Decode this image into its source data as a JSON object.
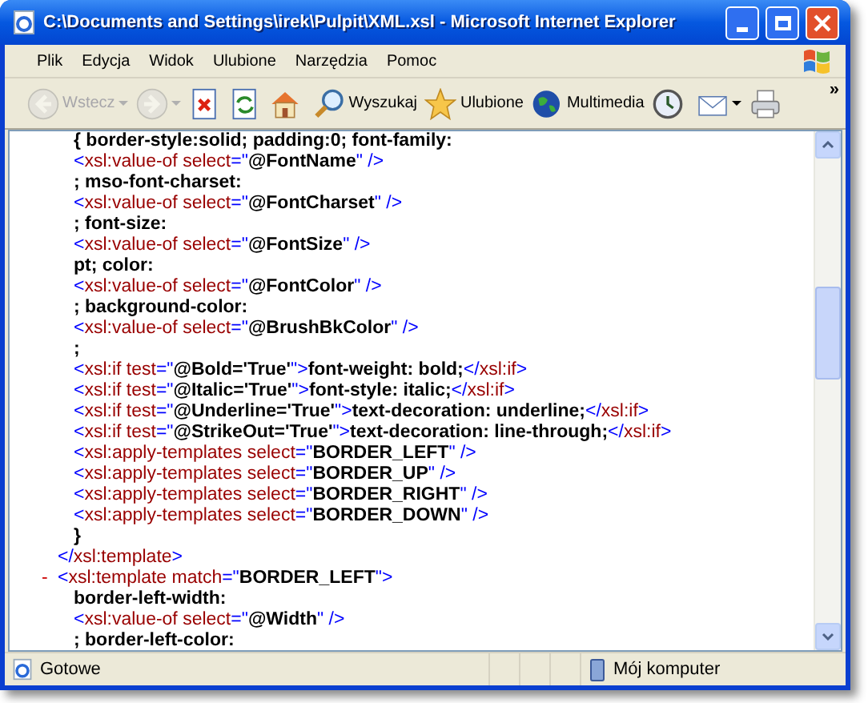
{
  "window": {
    "title": "C:\\Documents and Settings\\irek\\Pulpit\\XML.xsl - Microsoft Internet Explorer"
  },
  "menu": [
    "Plik",
    "Edycja",
    "Widok",
    "Ulubione",
    "Narzędzia",
    "Pomoc"
  ],
  "toolbar": [
    {
      "label": "Wstecz",
      "disabled": true,
      "dropdown": true
    },
    {
      "disabled": true,
      "dropdown": true
    },
    {
      "disabled": false
    },
    {
      "disabled": false
    },
    {
      "disabled": false
    },
    {
      "label": "Wyszukaj",
      "disabled": false
    },
    {
      "label": "Ulubione",
      "disabled": false
    },
    {
      "label": "Multimedia",
      "disabled": false
    },
    {
      "disabled": false
    },
    {
      "disabled": false,
      "dropdown": true
    },
    {
      "disabled": false
    }
  ],
  "toolbar_overflow": "»",
  "document": [
    {
      "children": [
        {
          "tokens": [
            {
              "kind": "text",
              "text": "{ border-style:solid; padding:0; font-family:"
            }
          ]
        },
        {
          "tokens": [
            {
              "kind": "markup",
              "text": "<"
            },
            {
              "kind": "name",
              "text": "xsl:value-of select"
            },
            {
              "kind": "markup",
              "text": "=\""
            },
            {
              "kind": "value",
              "text": "@FontName"
            },
            {
              "kind": "markup",
              "text": "\" />"
            }
          ]
        },
        {
          "tokens": [
            {
              "kind": "text",
              "text": "; mso-font-charset:"
            }
          ]
        },
        {
          "tokens": [
            {
              "kind": "markup",
              "text": "<"
            },
            {
              "kind": "name",
              "text": "xsl:value-of select"
            },
            {
              "kind": "markup",
              "text": "=\""
            },
            {
              "kind": "value",
              "text": "@FontCharset"
            },
            {
              "kind": "markup",
              "text": "\" />"
            }
          ]
        },
        {
          "tokens": [
            {
              "kind": "text",
              "text": "; font-size:"
            }
          ]
        },
        {
          "tokens": [
            {
              "kind": "markup",
              "text": "<"
            },
            {
              "kind": "name",
              "text": "xsl:value-of select"
            },
            {
              "kind": "markup",
              "text": "=\""
            },
            {
              "kind": "value",
              "text": "@FontSize"
            },
            {
              "kind": "markup",
              "text": "\" />"
            }
          ]
        },
        {
          "tokens": [
            {
              "kind": "text",
              "text": "pt; color:"
            }
          ]
        },
        {
          "tokens": [
            {
              "kind": "markup",
              "text": "<"
            },
            {
              "kind": "name",
              "text": "xsl:value-of select"
            },
            {
              "kind": "markup",
              "text": "=\""
            },
            {
              "kind": "value",
              "text": "@FontColor"
            },
            {
              "kind": "markup",
              "text": "\" />"
            }
          ]
        },
        {
          "tokens": [
            {
              "kind": "text",
              "text": "; background-color:"
            }
          ]
        },
        {
          "tokens": [
            {
              "kind": "markup",
              "text": "<"
            },
            {
              "kind": "name",
              "text": "xsl:value-of select"
            },
            {
              "kind": "markup",
              "text": "=\""
            },
            {
              "kind": "value",
              "text": "@BrushBkColor"
            },
            {
              "kind": "markup",
              "text": "\" />"
            }
          ]
        },
        {
          "tokens": [
            {
              "kind": "text",
              "text": ";"
            }
          ]
        },
        {
          "tokens": [
            {
              "kind": "markup",
              "text": "<"
            },
            {
              "kind": "name",
              "text": "xsl:if test"
            },
            {
              "kind": "markup",
              "text": "=\""
            },
            {
              "kind": "value",
              "text": "@Bold='True'"
            },
            {
              "kind": "markup",
              "text": "\">"
            },
            {
              "kind": "text",
              "text": "font-weight: bold;"
            },
            {
              "kind": "markup",
              "text": "</"
            },
            {
              "kind": "name",
              "text": "xsl:if"
            },
            {
              "kind": "markup",
              "text": ">"
            }
          ]
        },
        {
          "tokens": [
            {
              "kind": "markup",
              "text": "<"
            },
            {
              "kind": "name",
              "text": "xsl:if test"
            },
            {
              "kind": "markup",
              "text": "=\""
            },
            {
              "kind": "value",
              "text": "@Italic='True'"
            },
            {
              "kind": "markup",
              "text": "\">"
            },
            {
              "kind": "text",
              "text": "font-style: italic;"
            },
            {
              "kind": "markup",
              "text": "</"
            },
            {
              "kind": "name",
              "text": "xsl:if"
            },
            {
              "kind": "markup",
              "text": ">"
            }
          ]
        },
        {
          "tokens": [
            {
              "kind": "markup",
              "text": "<"
            },
            {
              "kind": "name",
              "text": "xsl:if test"
            },
            {
              "kind": "markup",
              "text": "=\""
            },
            {
              "kind": "value",
              "text": "@Underline='True'"
            },
            {
              "kind": "markup",
              "text": "\">"
            },
            {
              "kind": "text",
              "text": "text-decoration: underline;"
            },
            {
              "kind": "markup",
              "text": "</"
            },
            {
              "kind": "name",
              "text": "xsl:if"
            },
            {
              "kind": "markup",
              "text": ">"
            }
          ]
        },
        {
          "tokens": [
            {
              "kind": "markup",
              "text": "<"
            },
            {
              "kind": "name",
              "text": "xsl:if test"
            },
            {
              "kind": "markup",
              "text": "=\""
            },
            {
              "kind": "value",
              "text": "@StrikeOut='True'"
            },
            {
              "kind": "markup",
              "text": "\">"
            },
            {
              "kind": "text",
              "text": "text-decoration: line-through;"
            },
            {
              "kind": "markup",
              "text": "</"
            },
            {
              "kind": "name",
              "text": "xsl:if"
            },
            {
              "kind": "markup",
              "text": ">"
            }
          ]
        },
        {
          "tokens": [
            {
              "kind": "markup",
              "text": "<"
            },
            {
              "kind": "name",
              "text": "xsl:apply-templates select"
            },
            {
              "kind": "markup",
              "text": "=\""
            },
            {
              "kind": "value",
              "text": "BORDER_LEFT"
            },
            {
              "kind": "markup",
              "text": "\" />"
            }
          ]
        },
        {
          "tokens": [
            {
              "kind": "markup",
              "text": "<"
            },
            {
              "kind": "name",
              "text": "xsl:apply-templates select"
            },
            {
              "kind": "markup",
              "text": "=\""
            },
            {
              "kind": "value",
              "text": "BORDER_UP"
            },
            {
              "kind": "markup",
              "text": "\" />"
            }
          ]
        },
        {
          "tokens": [
            {
              "kind": "markup",
              "text": "<"
            },
            {
              "kind": "name",
              "text": "xsl:apply-templates select"
            },
            {
              "kind": "markup",
              "text": "=\""
            },
            {
              "kind": "value",
              "text": "BORDER_RIGHT"
            },
            {
              "kind": "markup",
              "text": "\" />"
            }
          ]
        },
        {
          "tokens": [
            {
              "kind": "markup",
              "text": "<"
            },
            {
              "kind": "name",
              "text": "xsl:apply-templates select"
            },
            {
              "kind": "markup",
              "text": "=\""
            },
            {
              "kind": "value",
              "text": "BORDER_DOWN"
            },
            {
              "kind": "markup",
              "text": "\" />"
            }
          ]
        },
        {
          "tokens": [
            {
              "kind": "text",
              "text": "}"
            }
          ]
        }
      ]
    },
    {
      "tokens": [
        {
          "kind": "markup",
          "text": "</"
        },
        {
          "kind": "name",
          "text": "xsl:template"
        },
        {
          "kind": "markup",
          "text": ">"
        }
      ]
    },
    {
      "toggle": "-",
      "tokens": [
        {
          "kind": "markup",
          "text": "<"
        },
        {
          "kind": "name",
          "text": "xsl:template match"
        },
        {
          "kind": "markup",
          "text": "=\""
        },
        {
          "kind": "value",
          "text": "BORDER_LEFT"
        },
        {
          "kind": "markup",
          "text": "\">"
        }
      ],
      "children": [
        {
          "tokens": [
            {
              "kind": "text",
              "text": "border-left-width:"
            }
          ]
        },
        {
          "tokens": [
            {
              "kind": "markup",
              "text": "<"
            },
            {
              "kind": "name",
              "text": "xsl:value-of select"
            },
            {
              "kind": "markup",
              "text": "=\""
            },
            {
              "kind": "value",
              "text": "@Width"
            },
            {
              "kind": "markup",
              "text": "\" />"
            }
          ]
        },
        {
          "tokens": [
            {
              "kind": "text",
              "text": "; border-left-color:"
            }
          ]
        }
      ]
    }
  ],
  "status_bar": {
    "text": "Gotowe",
    "zone": "Mój komputer"
  }
}
